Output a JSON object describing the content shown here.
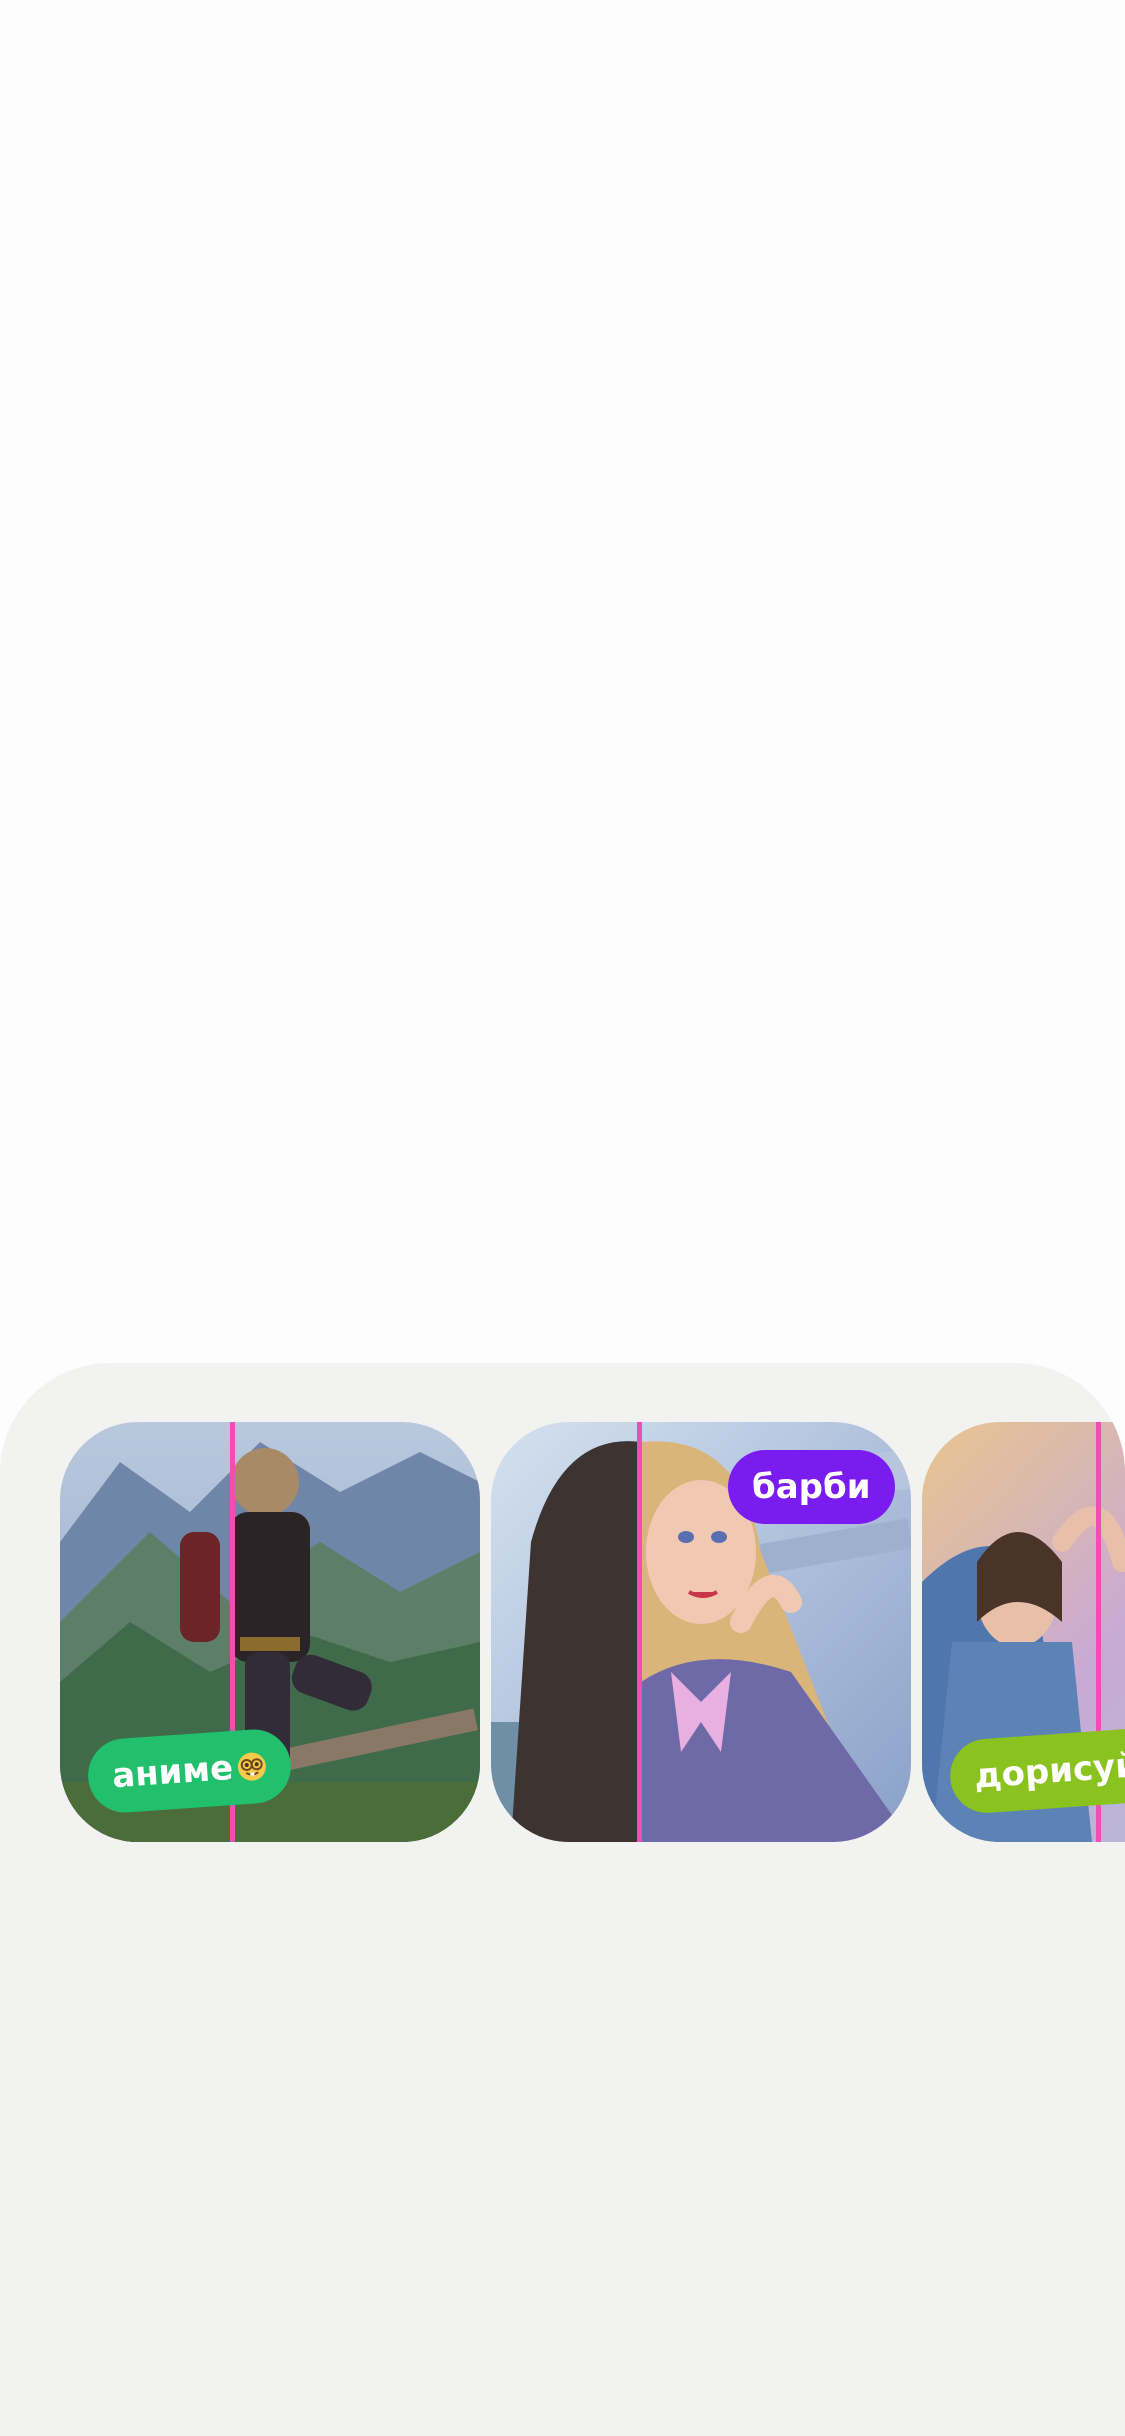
{
  "filters": {
    "items": [
      {
        "label": "аниме",
        "emoji": "nerd-face-emoji",
        "color": "#22c06d"
      },
      {
        "label": "барби",
        "emoji": "",
        "color": "#7a1cf0"
      },
      {
        "label": "дорисуй",
        "emoji": "",
        "color": "#8ac21f"
      }
    ],
    "divider_color": "#ee4fb4"
  },
  "colors": {
    "background": "#fdfdfd",
    "sheet": "#f2f2f1"
  }
}
